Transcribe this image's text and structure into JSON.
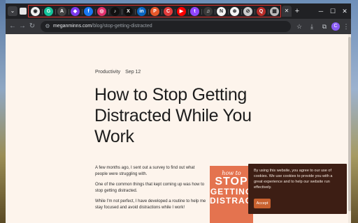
{
  "browser": {
    "tabs": [
      {
        "icon": "github-icon",
        "glyph": "◉",
        "color": "#f0f0f0"
      },
      {
        "icon": "grammarly-icon",
        "glyph": "G",
        "color": "#15c39a"
      },
      {
        "icon": "extension-icon",
        "glyph": "A",
        "color": "#444"
      },
      {
        "icon": "obsidian-icon",
        "glyph": "◆",
        "color": "#7c3aed"
      },
      {
        "icon": "facebook-icon",
        "glyph": "f",
        "color": "#1877f2"
      },
      {
        "icon": "instagram-icon",
        "glyph": "◎",
        "color": "#e1306c"
      },
      {
        "icon": "tiktok-icon",
        "glyph": "♪",
        "color": "#111"
      },
      {
        "icon": "x-icon",
        "glyph": "X",
        "color": "#111"
      },
      {
        "icon": "linkedin-icon",
        "glyph": "in",
        "color": "#0a66c2"
      },
      {
        "icon": "producthunt-icon",
        "glyph": "P",
        "color": "#e8582a"
      },
      {
        "icon": "canva-icon",
        "glyph": "C",
        "color": "#e23b3b"
      },
      {
        "icon": "youtube-icon",
        "glyph": "▶",
        "color": "#ff0000"
      },
      {
        "icon": "twitch-icon",
        "glyph": "t",
        "color": "#9146ff"
      },
      {
        "icon": "music-icon",
        "glyph": "♫",
        "color": "#3a3a3a"
      },
      {
        "icon": "notion-icon",
        "glyph": "N",
        "color": "#f5f5f5"
      },
      {
        "icon": "openai-icon",
        "glyph": "⊛",
        "color": "#f5f5f5"
      },
      {
        "icon": "compass-icon",
        "glyph": "⊘",
        "color": "#cccccc"
      },
      {
        "icon": "quora-icon",
        "glyph": "Q",
        "color": "#b92b27"
      },
      {
        "icon": "bookmark-icon",
        "glyph": "▦",
        "color": "#bbbbbb"
      }
    ],
    "active_tab_close": "✕",
    "new_tab": "+",
    "url_host": "meganminns.com",
    "url_path": "/blog/stop-getting-distracted",
    "profile_initial": "C"
  },
  "article": {
    "category": "Productivity",
    "date": "Sep 12",
    "title": "How to Stop Getting Distracted While You Work",
    "paragraphs": [
      "A few months ago, I sent out a survey to find out what people were struggling with.",
      "One of the common things that kept coming up was how to stop getting distracted.",
      "While I'm not perfect, I have developed a routine to help me stay focused and avoid distractions while I work!"
    ]
  },
  "book": {
    "line1": "how to",
    "line2": "STOP",
    "line3": "GETTING",
    "line4": "DISTRACT"
  },
  "cookie": {
    "message": "By using this website, you agree to our use of cookies. We use cookies to provide you with a great experience and to help our website run effectively.",
    "accept_label": "Accept"
  }
}
